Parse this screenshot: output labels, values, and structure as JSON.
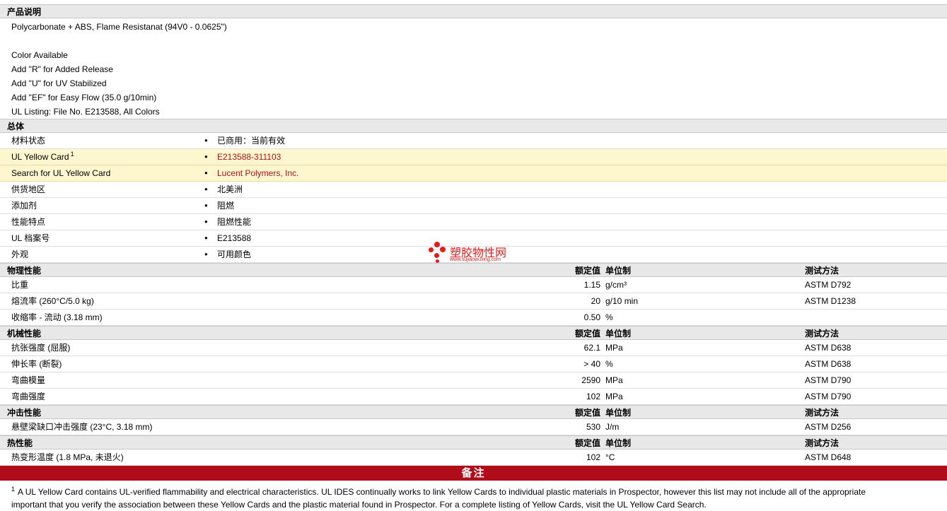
{
  "product_description": {
    "header": "产品说明",
    "lines": [
      "Polycarbonate + ABS, Flame Resistanat (94V0 - 0.0625\")",
      "",
      "Color Available",
      "Add \"R\" for Added Release",
      "Add \"U\" for UV Stabilized",
      "Add \"EF\" for Easy Flow (35.0 g/10min)",
      "UL Listing: File No. E213588, All Colors"
    ]
  },
  "general": {
    "header": "总体",
    "rows": [
      {
        "label": "材料状态",
        "value": "已商用：当前有效"
      },
      {
        "label": "UL Yellow Card",
        "sup": "1",
        "value": "E213588-311103"
      },
      {
        "label": "Search for UL Yellow Card",
        "value": "Lucent Polymers, Inc."
      },
      {
        "label": "供货地区",
        "value": "北美洲"
      },
      {
        "label": "添加剂",
        "value": "阻燃"
      },
      {
        "label": "性能特点",
        "value": "阻燃性能"
      },
      {
        "label": "UL 档案号",
        "value": "E213588"
      },
      {
        "label": "外观",
        "value": "可用颜色"
      }
    ]
  },
  "columns": {
    "value": "额定值",
    "unit": "单位制",
    "test": "测试方法"
  },
  "physical": {
    "header": "物理性能",
    "rows": [
      {
        "label": "比重",
        "value": "1.15",
        "unit": "g/cm³",
        "test": "ASTM D792"
      },
      {
        "label": "熔流率 (260°C/5.0 kg)",
        "value": "20",
        "unit": "g/10 min",
        "test": "ASTM D1238"
      },
      {
        "label": "收缩率  - 流动 (3.18 mm)",
        "value": "0.50",
        "unit": "%",
        "test": ""
      }
    ]
  },
  "mechanical": {
    "header": "机械性能",
    "rows": [
      {
        "label": "抗张强度 (屈服)",
        "value": "62.1",
        "unit": "MPa",
        "test": "ASTM D638"
      },
      {
        "label": "伸长率 (断裂)",
        "value": "> 40",
        "unit": "%",
        "test": "ASTM D638"
      },
      {
        "label": "弯曲模量",
        "value": "2590",
        "unit": "MPa",
        "test": "ASTM D790"
      },
      {
        "label": "弯曲强度",
        "value": "102",
        "unit": "MPa",
        "test": "ASTM D790"
      }
    ]
  },
  "impact": {
    "header": "冲击性能",
    "rows": [
      {
        "label": "悬壁梁缺口冲击强度 (23°C, 3.18 mm)",
        "value": "530",
        "unit": "J/m",
        "test": "ASTM D256"
      }
    ]
  },
  "thermal": {
    "header": "热性能",
    "rows": [
      {
        "label": "热变形温度 (1.8 MPa, 未退火)",
        "value": "102",
        "unit": "°C",
        "test": "ASTM D648"
      }
    ]
  },
  "notes": {
    "header": "备注",
    "sup": "1",
    "line1": "A UL Yellow Card contains UL-verified flammability and electrical characteristics. UL IDES continually works to link Yellow Cards to individual plastic materials in Prospector, however this list may not include all of the appropriate",
    "line2": "important that you verify the association between these Yellow Cards and the plastic material found in Prospector. For a complete listing of Yellow Cards, visit the UL Yellow Card Search."
  },
  "watermark": {
    "title": "塑胶物性网",
    "url": "www.sujiaowuxing.com"
  },
  "colors": {
    "accent": "#b00c1a",
    "link": "#b01218",
    "highlight": "#fdf6cf"
  }
}
